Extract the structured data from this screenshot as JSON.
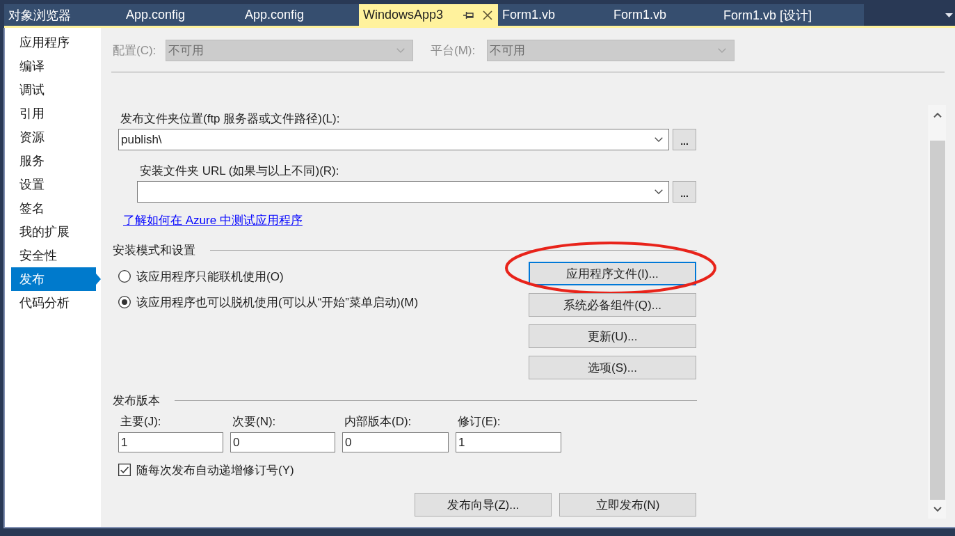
{
  "tabs": [
    {
      "label": "对象浏览器",
      "selected": false
    },
    {
      "label": "App.config",
      "selected": false
    },
    {
      "label": "App.config",
      "selected": false
    },
    {
      "label": "WindowsApp3",
      "selected": true
    },
    {
      "label": "Form1.vb",
      "selected": false
    },
    {
      "label": "Form1.vb",
      "selected": false
    },
    {
      "label": "Form1.vb [设计]",
      "selected": false
    }
  ],
  "sidebar": {
    "items": [
      {
        "label": "应用程序",
        "selected": false
      },
      {
        "label": "编译",
        "selected": false
      },
      {
        "label": "调试",
        "selected": false
      },
      {
        "label": "引用",
        "selected": false
      },
      {
        "label": "资源",
        "selected": false
      },
      {
        "label": "服务",
        "selected": false
      },
      {
        "label": "设置",
        "selected": false
      },
      {
        "label": "签名",
        "selected": false
      },
      {
        "label": "我的扩展",
        "selected": false
      },
      {
        "label": "安全性",
        "selected": false
      },
      {
        "label": "发布",
        "selected": true
      },
      {
        "label": "代码分析",
        "selected": false
      }
    ]
  },
  "configuration": {
    "label": "配置(C):",
    "value": "不可用",
    "disabled": true
  },
  "platform": {
    "label": "平台(M):",
    "value": "不可用",
    "disabled": true
  },
  "publish_location": {
    "label": "发布文件夹位置(ftp 服务器或文件路径)(L):",
    "value": "publish\\",
    "browse_button": "..."
  },
  "installation_url": {
    "label": "安装文件夹 URL (如果与以上不同)(R):",
    "browse_button": "..."
  },
  "azure_link": "了解如何在 Azure 中测试应用程序",
  "install_mode": {
    "title": "安装模式和设置",
    "options": [
      {
        "label": "该应用程序只能联机使用(O)",
        "selected": false
      },
      {
        "label": "该应用程序也可以脱机使用(可以从“开始”菜单启动)(M)",
        "selected": true
      }
    ],
    "buttons": [
      {
        "label": "应用程序文件(I)...",
        "focused": true,
        "circled": true
      },
      {
        "label": "系统必备组件(Q)...",
        "focused": false,
        "circled": false
      },
      {
        "label": "更新(U)...",
        "focused": false,
        "circled": false
      },
      {
        "label": "选项(S)...",
        "focused": false,
        "circled": false
      }
    ]
  },
  "publish_version": {
    "title": "发布版本",
    "fields": [
      {
        "label": "主要(J):",
        "value": "1"
      },
      {
        "label": "次要(N):",
        "value": "0"
      },
      {
        "label": "内部版本(D):",
        "value": "0"
      },
      {
        "label": "修订(E):",
        "value": "1"
      }
    ],
    "auto_increment": {
      "label": "随每次发布自动递增修订号(Y)",
      "checked": true
    }
  },
  "actions": [
    {
      "label": "发布向导(Z)..."
    },
    {
      "label": "立即发布(N)"
    }
  ]
}
